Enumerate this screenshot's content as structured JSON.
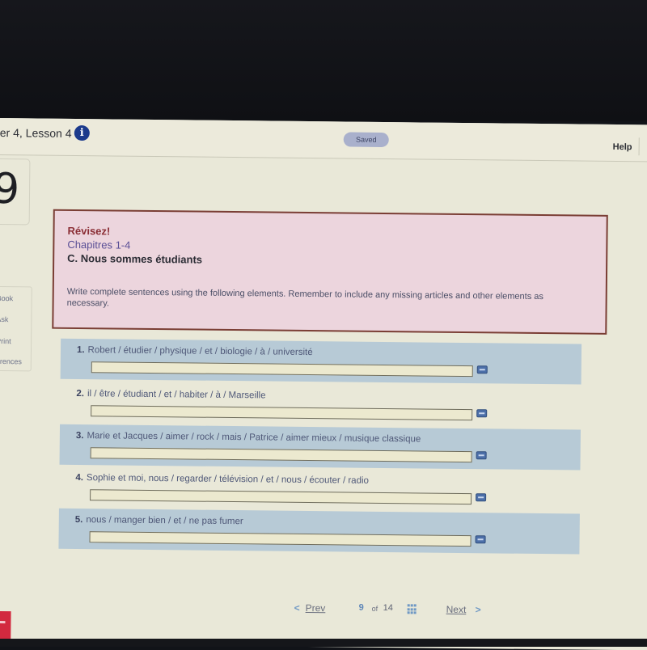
{
  "header": {
    "lesson_title": "er 4, Lesson 4",
    "info_icon": "info-icon",
    "saved_label": "Saved",
    "help_label": "Help"
  },
  "sidebar": {
    "question_number": "9",
    "tools": [
      {
        "label": "Book"
      },
      {
        "label": "Ask"
      },
      {
        "label": "Print"
      },
      {
        "label": "erences"
      }
    ]
  },
  "prompt": {
    "heading": "Révisez!",
    "chapters": "Chapitres 1-4",
    "section": "C. Nous sommes étudiants",
    "instructions": "Write complete sentences using the following elements. Remember to include any missing articles and other elements as necessary."
  },
  "questions": [
    {
      "number": "1.",
      "text": "Robert / étudier / physique / et / biologie / à / université",
      "answer": ""
    },
    {
      "number": "2.",
      "text": "il / être / étudiant / et / habiter / à / Marseille",
      "answer": ""
    },
    {
      "number": "3.",
      "text": "Marie et Jacques / aimer / rock / mais / Patrice / aimer mieux / musique classique",
      "answer": ""
    },
    {
      "number": "4.",
      "text": "Sophie et moi, nous / regarder / télévision / et / nous / écouter / radio",
      "answer": ""
    },
    {
      "number": "5.",
      "text": "nous / manger bien / et / ne pas fumer",
      "answer": ""
    }
  ],
  "pager": {
    "prev_icon": "<",
    "prev_label": "Prev",
    "current_page": "9",
    "of_label": "of",
    "total_pages": "14",
    "next_label": "Next",
    "next_icon": ">"
  },
  "colors": {
    "prompt_background": "#ecd5dd",
    "prompt_border": "#7a3e34",
    "heading_red": "#8a2d34",
    "chapters_purple": "#5a4f96",
    "question_shade": "#b7cad6",
    "accent_blue": "#6f98c4",
    "info_blue": "#1b3a8c"
  }
}
